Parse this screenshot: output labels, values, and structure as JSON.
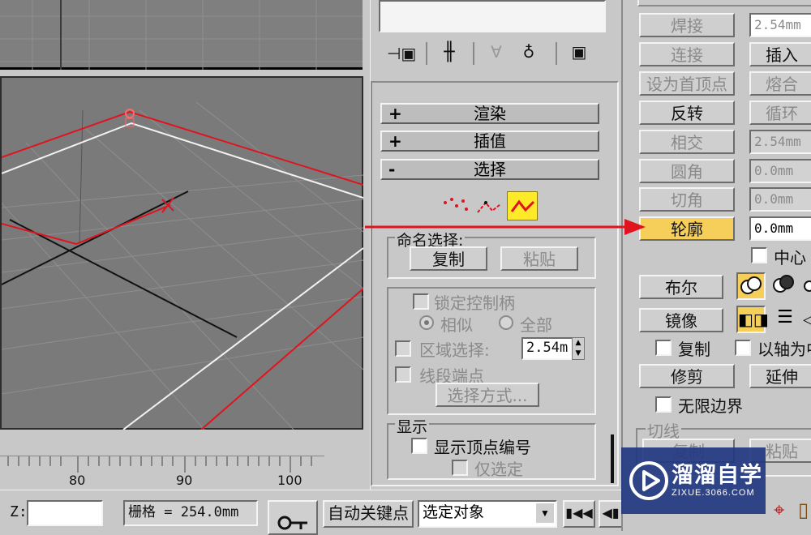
{
  "viewport": {
    "ruler_ticks": [
      "80",
      "90",
      "100"
    ]
  },
  "status": {
    "z_label": "Z:",
    "z_value": "",
    "grid_text": "栅格 = 254.0mm",
    "auto_key": "自动关键点",
    "selection_dropdown": "选定对象"
  },
  "command_panel": {
    "rollouts": [
      {
        "sign": "+",
        "label": "渲染"
      },
      {
        "sign": "+",
        "label": "插值"
      },
      {
        "sign": "-",
        "label": "选择"
      }
    ],
    "named_selection": {
      "title": "命名选择:",
      "copy": "复制",
      "paste": "粘贴"
    },
    "lock_handles": "锁定控制柄",
    "similar": "相似",
    "all": "全部",
    "area_select": "区域选择:",
    "area_value": "2.54m",
    "segment_end": "线段端点",
    "select_by": "选择方式...",
    "display": {
      "title": "显示",
      "show_vertex_numbers": "显示顶点编号",
      "selected_only": "仅选定"
    }
  },
  "geometry_panel": {
    "weld": "焊接",
    "weld_value": "2.54mm",
    "connect": "连接",
    "insert": "插入",
    "make_first": "设为首顶点",
    "fuse": "熔合",
    "reverse": "反转",
    "cycle": "循环",
    "crossinsert": "相交",
    "crossinsert_value": "2.54mm",
    "fillet": "圆角",
    "fillet_value": "0.0mm",
    "chamfer": "切角",
    "chamfer_value": "0.0mm",
    "outline": "轮廓",
    "outline_value": "0.0mm",
    "center": "中心",
    "boolean": "布尔",
    "mirror": "镜像",
    "copy": "复制",
    "about_pivot": "以轴为中",
    "trim": "修剪",
    "extend": "延伸",
    "infinite_bounds": "无限边界",
    "tangent": {
      "title": "切线",
      "copy": "复制",
      "paste": "粘贴"
    }
  },
  "watermark": {
    "brand": "溜溜自学",
    "url": "ZIXUE.3066.COM"
  },
  "colors": {
    "highlight": "#f5cf5a",
    "arrow": "#e0141e",
    "viewport_bg": "#7a7a7a"
  }
}
